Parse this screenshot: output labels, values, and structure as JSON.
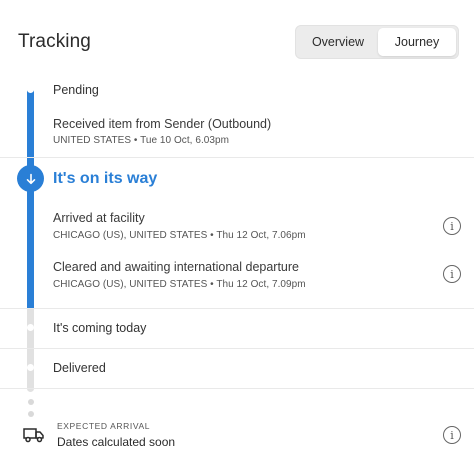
{
  "header": {
    "title": "Tracking",
    "tabs": [
      {
        "label": "Overview",
        "active": false
      },
      {
        "label": "Journey",
        "active": true
      }
    ]
  },
  "steps": {
    "pending": {
      "label": "Pending",
      "event": {
        "title": "Received item from Sender (Outbound)",
        "detail": "UNITED STATES • Tue 10 Oct, 6.03pm"
      }
    },
    "on_its_way": {
      "label": "It's on its way",
      "events": [
        {
          "title": "Arrived at facility",
          "detail": "CHICAGO (US), UNITED STATES • Thu 12 Oct, 7.06pm"
        },
        {
          "title": "Cleared and awaiting international departure",
          "detail": "CHICAGO (US), UNITED STATES • Thu 12 Oct, 7.09pm"
        }
      ]
    },
    "coming_today": {
      "label": "It's coming today"
    },
    "delivered": {
      "label": "Delivered"
    }
  },
  "expected_arrival": {
    "label": "EXPECTED ARRIVAL",
    "value": "Dates calculated soon"
  },
  "colors": {
    "accent": "#2a7fd6",
    "track_inactive": "#e1e1e1"
  },
  "icons": [
    "arrow-down-icon",
    "info-icon",
    "truck-icon"
  ]
}
